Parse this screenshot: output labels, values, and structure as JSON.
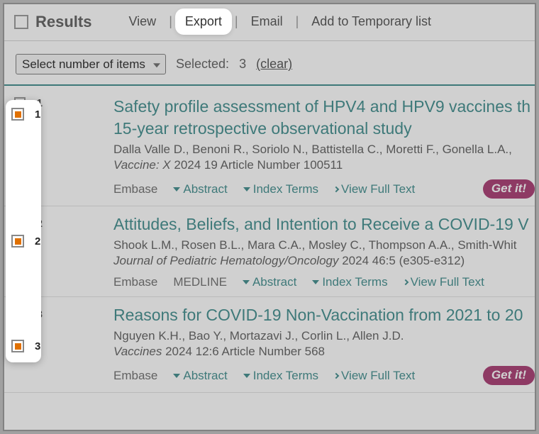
{
  "header": {
    "results_label": "Results",
    "view": "View",
    "export": "Export",
    "email": "Email",
    "add_temp": "Add to Temporary list"
  },
  "controls": {
    "select_placeholder": "Select number of items",
    "selected_label": "Selected:",
    "selected_count": "3",
    "clear": "(clear)"
  },
  "labels": {
    "abstract": "Abstract",
    "index_terms": "Index Terms",
    "view_full": "View Full Text",
    "getit": "Get it!"
  },
  "results": [
    {
      "num": "1",
      "title": "Safety profile assessment of HPV4 and HPV9 vaccines th 15-year retrospective observational study",
      "authors": "Dalla Valle D., Benoni R., Soriolo N., Battistella C., Moretti F., Gonella L.A.,",
      "journal": "Vaccine: X",
      "pub": " 2024 19 Article Number 100511",
      "dbs": [
        "Embase"
      ],
      "getit": true
    },
    {
      "num": "2",
      "title": "Attitudes, Beliefs, and Intention to Receive a COVID-19 V",
      "authors": "Shook L.M., Rosen B.L., Mara C.A., Mosley C., Thompson A.A., Smith-Whit",
      "journal": "Journal of Pediatric Hematology/Oncology",
      "pub": " 2024 46:5 (e305-e312)",
      "dbs": [
        "Embase",
        "MEDLINE"
      ],
      "getit": false
    },
    {
      "num": "3",
      "title": "Reasons for COVID-19 Non-Vaccination from 2021 to 20",
      "authors": "Nguyen K.H., Bao Y., Mortazavi J., Corlin L., Allen J.D.",
      "journal": "Vaccines",
      "pub": " 2024 12:6 Article Number 568",
      "dbs": [
        "Embase"
      ],
      "getit": true
    }
  ]
}
